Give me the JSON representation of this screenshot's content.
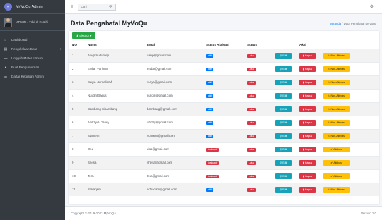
{
  "brand": {
    "name": "MyVoQu Admin"
  },
  "user": {
    "name": "ADMIN - Zaki Al Farabi"
  },
  "sidebar": {
    "items": [
      {
        "label": "Dashboard",
        "icon": "home-icon"
      },
      {
        "label": "Pengelolaan Data",
        "icon": "table-icon",
        "caret": "‹"
      },
      {
        "label": "Unggah Materi Umum",
        "icon": "book-icon"
      },
      {
        "label": "Buat Pengumuman",
        "icon": "info-icon"
      },
      {
        "label": "Daftar Kegiatan Admin",
        "icon": "list-icon"
      }
    ]
  },
  "topbar": {
    "search_placeholder": "Cari"
  },
  "page": {
    "title": "Data Pengahafal MyVoQu"
  },
  "breadcrumb": {
    "home": "Beranda",
    "separator": "/",
    "current": "Data Penghafal MyVoqu"
  },
  "toolbar": {
    "export_label": "Ekspor ▾"
  },
  "table": {
    "headers": {
      "no": "NO",
      "nama": "Nama",
      "email": "Email",
      "status_aktivasi": "Status Aktivasi",
      "status": "Status",
      "aksi": "Aksi"
    },
    "edit_label": "Edit",
    "delete_label": "Hapus",
    "rows": [
      {
        "no": "1",
        "nama": "Asep Sudarsep",
        "email": "asep@gmail.com",
        "aktivasi": "aktif",
        "status": "Lulus",
        "action": "Non-Aktivasi"
      },
      {
        "no": "2",
        "nama": "Endar Pariinan",
        "email": "endar@gmail.com",
        "aktivasi": "aktif",
        "status": "Lulus",
        "action": "Non-Aktivasi"
      },
      {
        "no": "3",
        "nama": "Surya Nurhalimah",
        "email": "surya@gmail.com",
        "aktivasi": "aktif",
        "status": "Lulus",
        "action": "Non-Aktivasi"
      },
      {
        "no": "4",
        "nama": "Nurdin Bagus",
        "email": "nurdin@gmail.com",
        "aktivasi": "aktif",
        "status": "Lulus",
        "action": "Non-Aktivasi"
      },
      {
        "no": "5",
        "nama": "Bambang Sibambang",
        "email": "bambang@gmail.com",
        "aktivasi": "aktif",
        "status": "Lulus",
        "action": "Non-Aktivasi"
      },
      {
        "no": "6",
        "nama": "Abizzy Al Taney",
        "email": "abizzy@gmail.com",
        "aktivasi": "aktif",
        "status": "Lulus",
        "action": "Non-Aktivasi"
      },
      {
        "no": "7",
        "nama": "Sunnem",
        "email": "sunnem@gmail.com",
        "aktivasi": "aktif",
        "status": "Lulus",
        "action": "Non-Aktivasi"
      },
      {
        "no": "8",
        "nama": "Dea",
        "email": "dea@gmail.com",
        "aktivasi": "tidak aktif",
        "status": "Lulus",
        "action": "Aktivasi"
      },
      {
        "no": "9",
        "nama": "Shesa",
        "email": "shesa@gmail.com",
        "aktivasi": "tidak aktif",
        "status": "Lulus",
        "action": "Aktivasi"
      },
      {
        "no": "10",
        "nama": "Tera",
        "email": "tera@gmail.com",
        "aktivasi": "tidak aktif",
        "status": "Lulus",
        "action": "Aktivasi"
      },
      {
        "no": "11",
        "nama": "Sobaqam",
        "email": "sobaqam@gmail.com",
        "aktivasi": "aktif",
        "status": "Lulus",
        "action": "Non-Aktivasi"
      }
    ]
  },
  "footer": {
    "copyright": "Copyright © 2019-2023 MyVoQu.",
    "version": "Version 1.0"
  },
  "colors": {
    "sidebar": "#343a40",
    "primary": "#007bff",
    "success": "#28a745",
    "danger": "#dc3545",
    "info": "#17a2b8",
    "warning": "#ffc107"
  }
}
